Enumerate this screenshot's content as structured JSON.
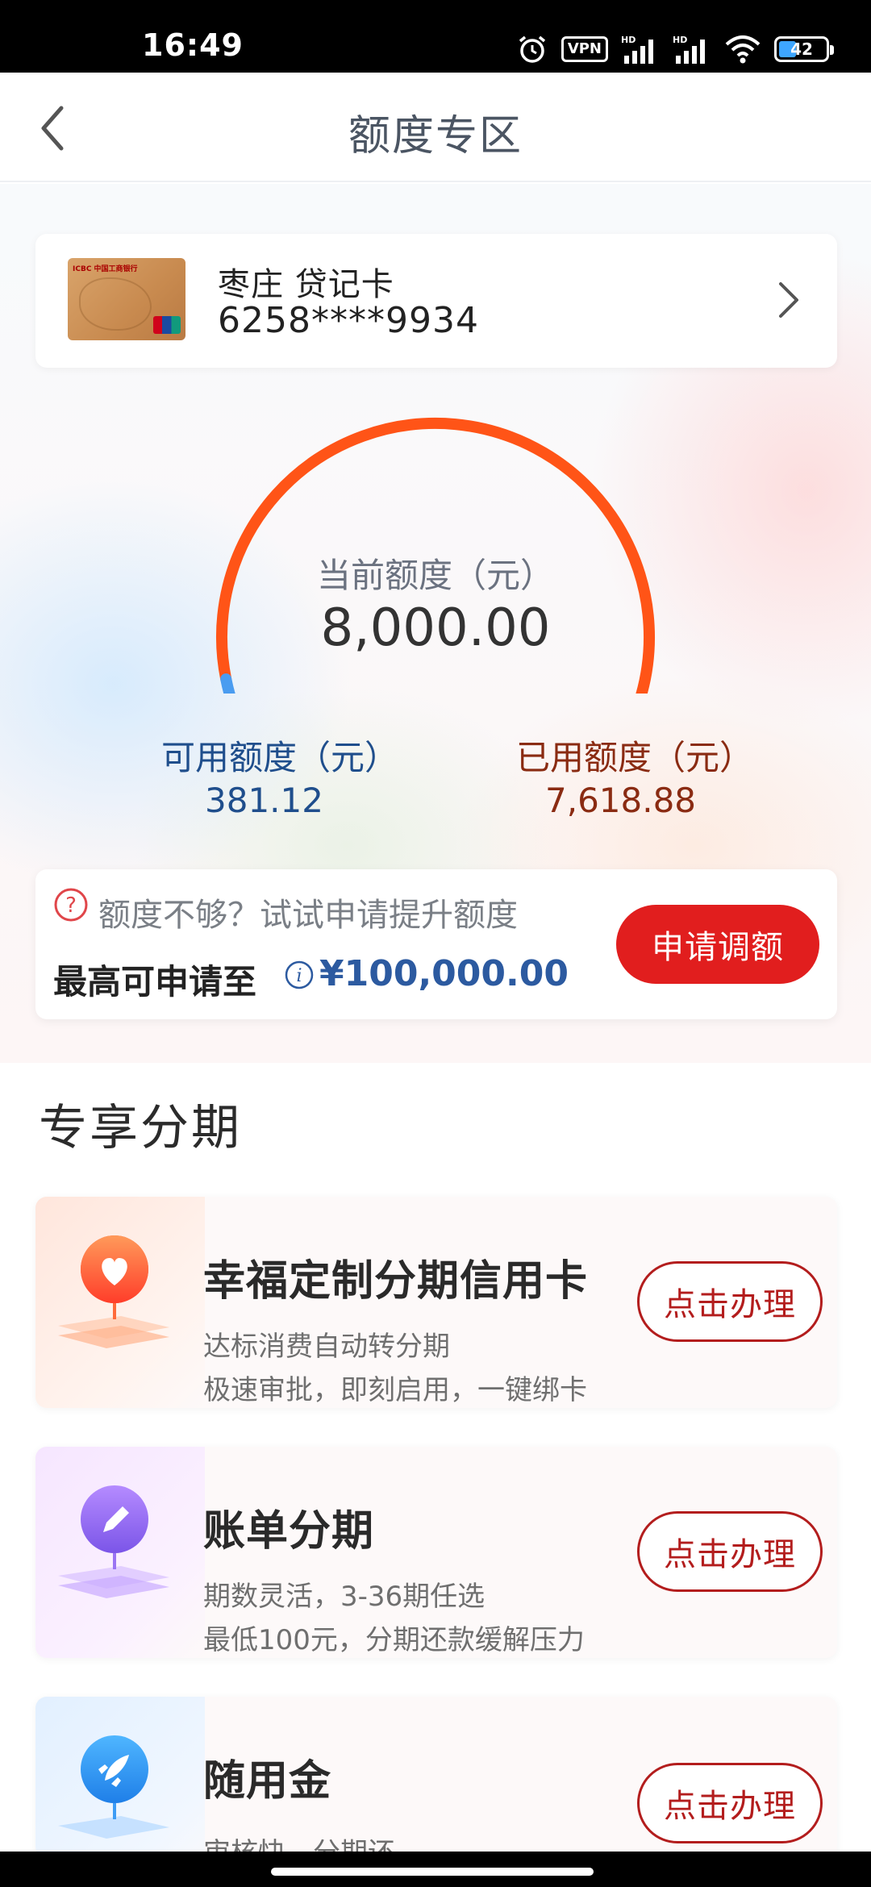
{
  "status_bar": {
    "time": "16:49",
    "vpn_label": "VPN",
    "battery_level": "42",
    "icons": [
      "alarm-icon",
      "vpn-icon",
      "hd-signal-icon",
      "hd-signal-icon",
      "wifi-icon",
      "battery-icon"
    ]
  },
  "nav": {
    "title": "额度专区",
    "back_icon": "chevron-left-icon"
  },
  "card": {
    "name": "枣庄 贷记卡",
    "number": "6258****9934"
  },
  "gauge": {
    "label": "当前额度（元）",
    "total": "8,000.00",
    "available_fraction": 0.0476,
    "available_color": "#4a9cf0",
    "used_color": "#ff5417"
  },
  "stats": {
    "available_label": "可用额度（元）",
    "available_value": "381.12",
    "used_label": "已用额度（元）",
    "used_value": "7,618.88"
  },
  "promo": {
    "tip": "额度不够？试试申请提升额度",
    "max_label": "最高可申请至",
    "max_amount": "¥100,000.00",
    "button": "申请调额"
  },
  "section": {
    "title": "专享分期"
  },
  "offers": [
    {
      "title": "幸福定制分期信用卡",
      "line1": "达标消费自动转分期",
      "line2": "极速审批，即刻启用，一键绑卡",
      "button": "点击办理",
      "icon": "heart-icon"
    },
    {
      "title": "账单分期",
      "line1": "期数灵活，3-36期任选",
      "line2": "最低100元，分期还款缓解压力",
      "button": "点击办理",
      "icon": "pencil-icon"
    },
    {
      "title": "随用金",
      "line1": "审核快，分期还",
      "button": "点击办理",
      "icon": "rocket-icon"
    }
  ]
}
